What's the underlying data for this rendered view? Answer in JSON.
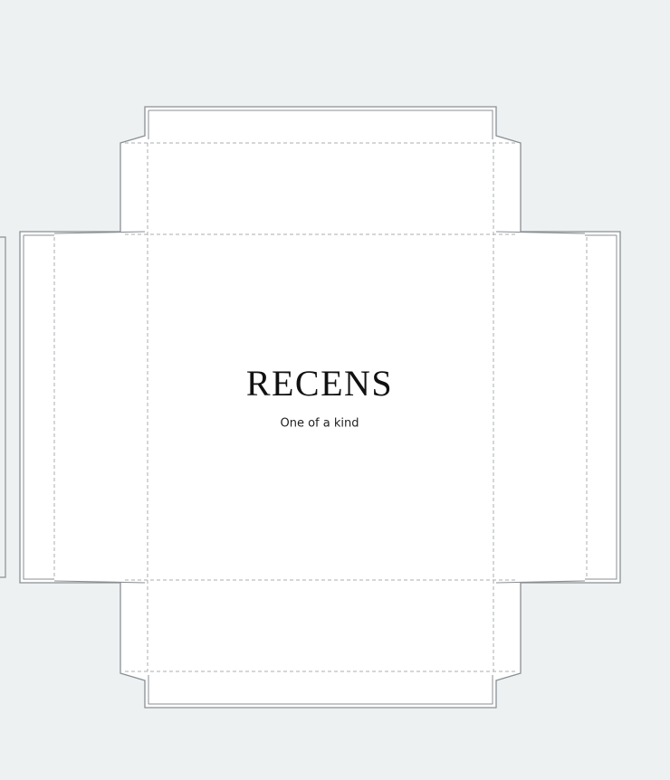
{
  "colors": {
    "background": "#eef1f2",
    "panel_fill": "#ffffff",
    "cut_line": "#8a8f93",
    "fold_line": "#a9adb1",
    "text": "#111111"
  },
  "label": {
    "brand": "RECENS",
    "tagline": "One of a kind"
  }
}
